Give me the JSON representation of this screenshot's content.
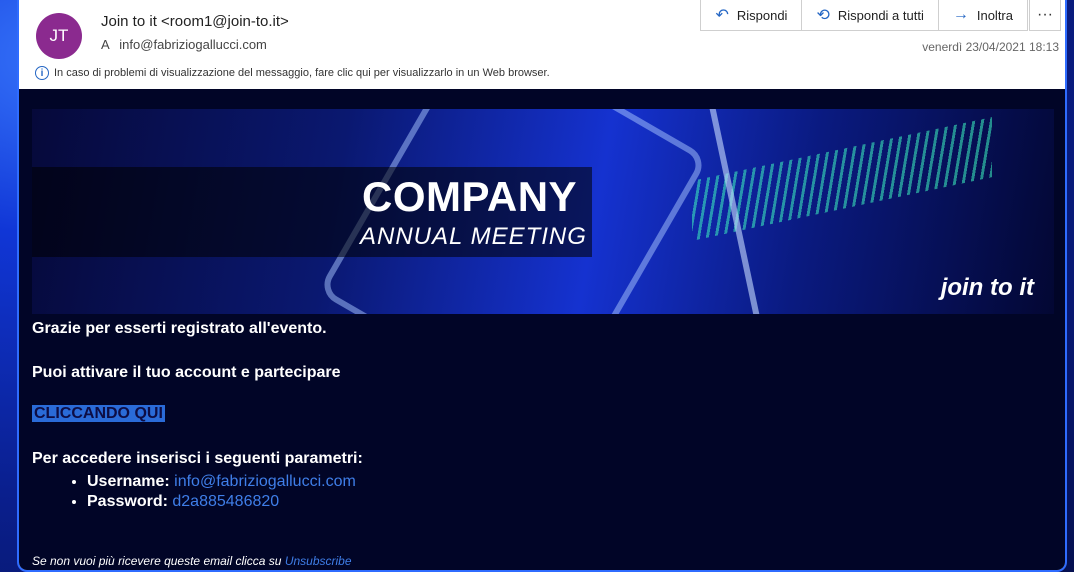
{
  "header": {
    "avatar_initials": "JT",
    "sender": "Join to it <room1@join-to.it>",
    "to_prefix": "A",
    "to": "info@fabriziogallucci.com",
    "date": "venerdì 23/04/2021 18:13",
    "info_text": "In caso di problemi di visualizzazione del messaggio, fare clic qui per visualizzarlo in un Web browser.",
    "actions": [
      {
        "label": "Rispondi",
        "icon": "reply-icon"
      },
      {
        "label": "Rispondi a tutti",
        "icon": "reply-all-icon"
      },
      {
        "label": "Inoltra",
        "icon": "forward-icon"
      }
    ]
  },
  "banner": {
    "title": "COMPANY",
    "subtitle": "ANNUAL MEETING",
    "logo": "join to it"
  },
  "body": {
    "thanks": "Grazie per esserti registrato all'evento.",
    "activate": "Puoi attivare il tuo account e partecipare",
    "cta": "CLICCANDO QUI",
    "params_intro": "Per accedere inserisci i seguenti parametri:",
    "username_label": "Username",
    "username_value": "info@fabriziogallucci.com",
    "password_label": "Password",
    "password_value": "d2a885486820",
    "footer_text": "Se non vuoi più ricevere queste email clicca su",
    "unsubscribe": "Unsubscribe"
  },
  "colors": {
    "accent": "#2466c4",
    "avatar": "#8b2a8f",
    "body_bg": "#010527",
    "link": "#3f7ee8"
  }
}
